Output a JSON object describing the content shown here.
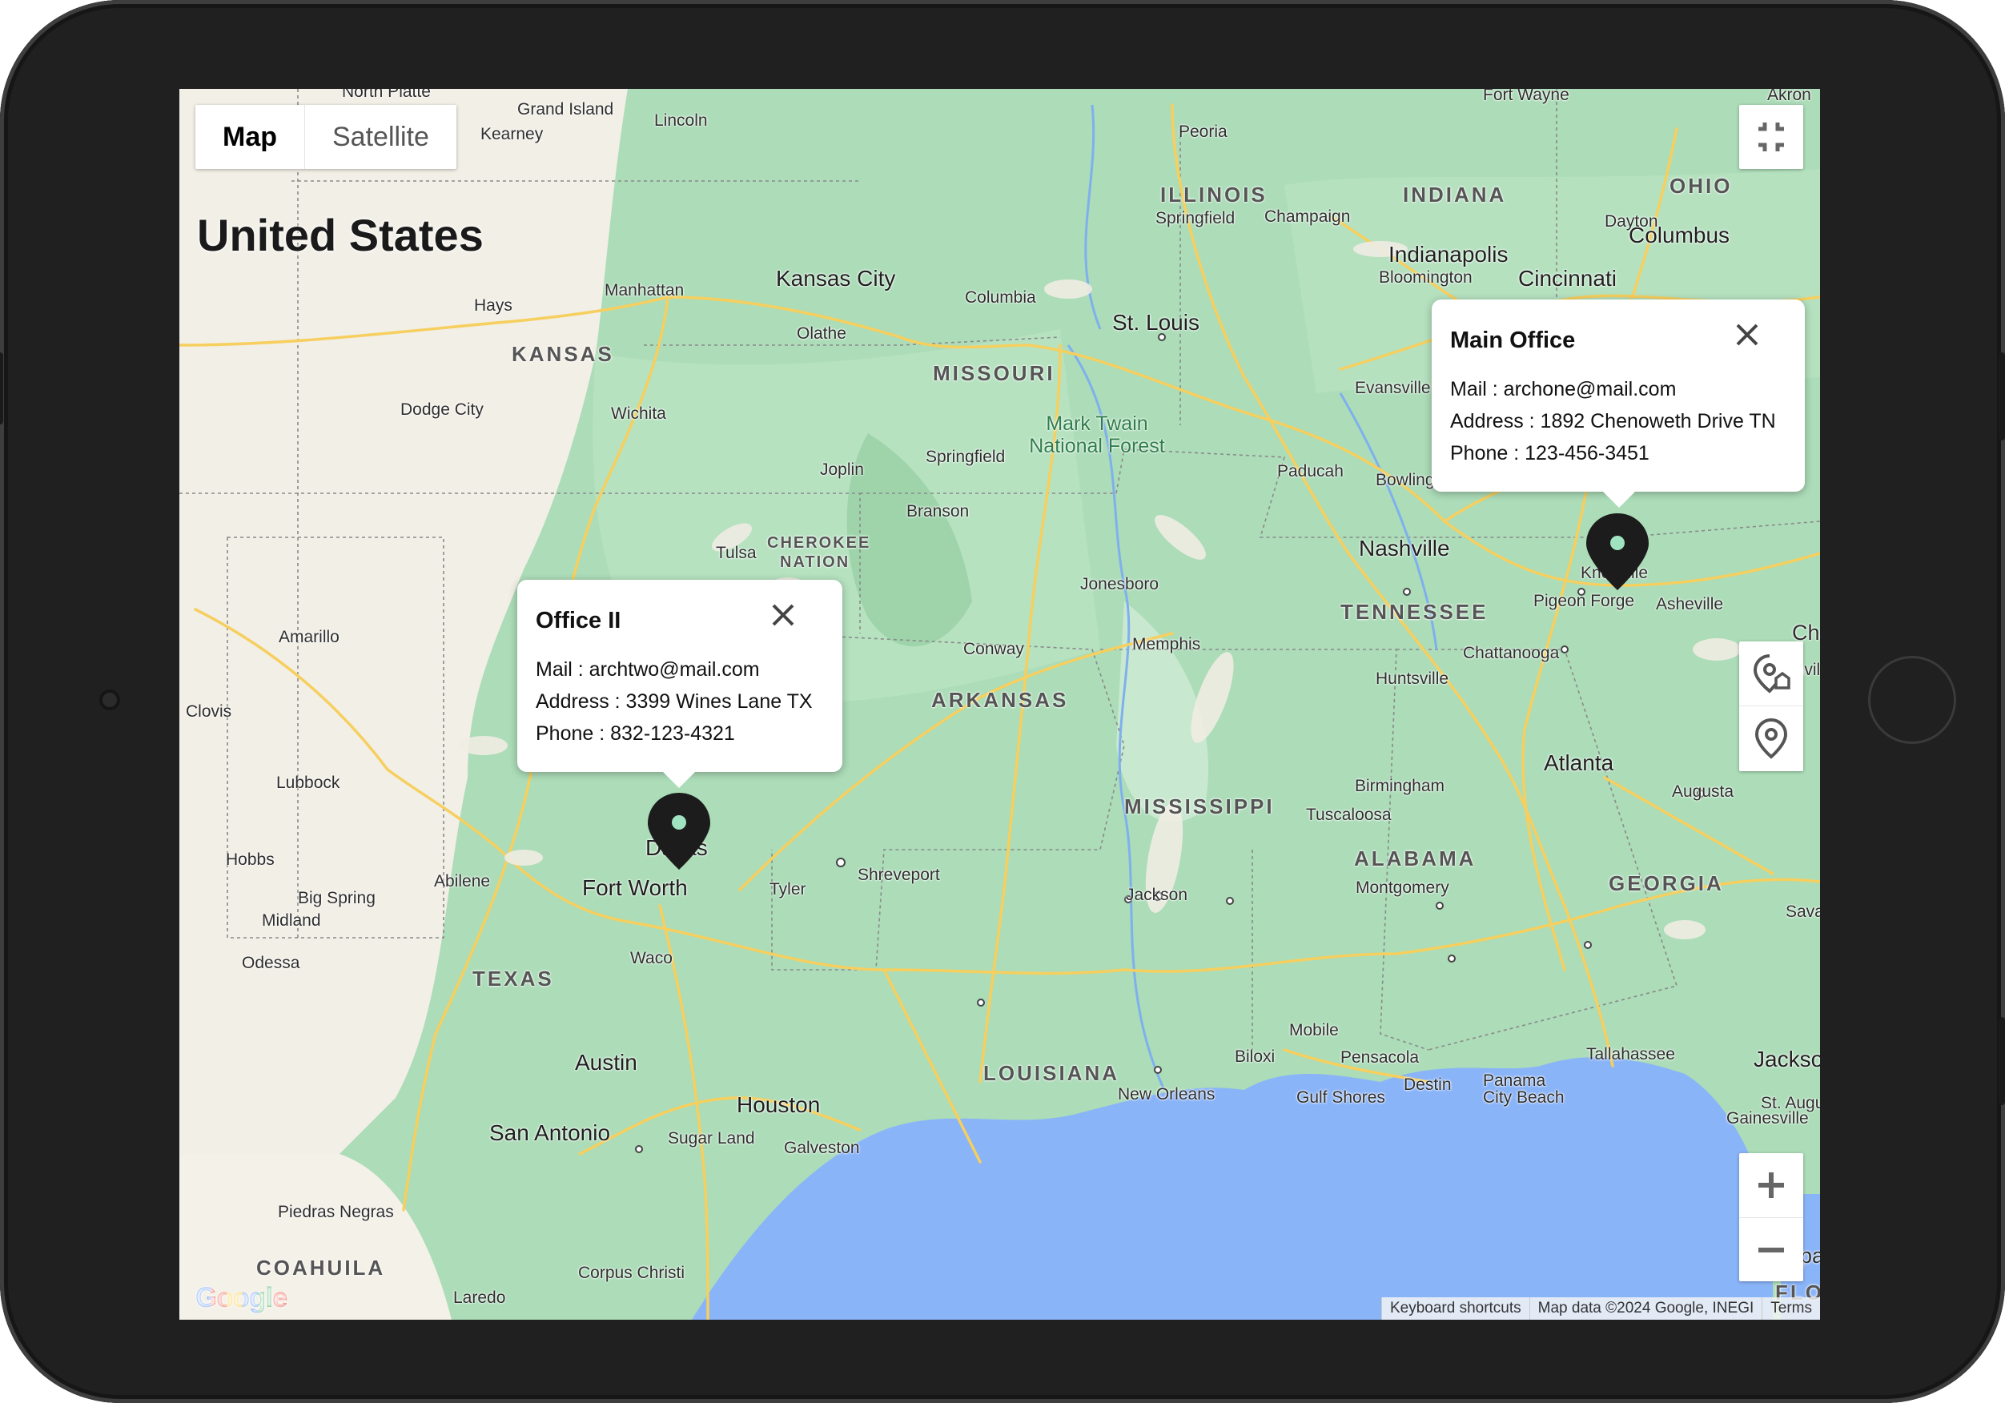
{
  "map": {
    "type_control": {
      "map_label": "Map",
      "satellite_label": "Satellite"
    },
    "country_label": "United States",
    "states": [
      "KANSAS",
      "MISSOURI",
      "ILLINOIS",
      "INDIANA",
      "OHIO",
      "TENNESSEE",
      "ARKANSAS",
      "MISSISSIPPI",
      "ALABAMA",
      "GEORGIA",
      "TEXAS",
      "LOUISIANA",
      "CHEROKEE",
      "NATION",
      "COAHUILA",
      "FLORIDA"
    ],
    "big_cities": [
      "Kansas City",
      "St. Louis",
      "Indianapolis",
      "Columbus",
      "Cincinnati",
      "Nashville",
      "Atlanta",
      "Fort Worth",
      "Dallas",
      "Austin",
      "Houston",
      "San Antonio",
      "Jacksonville"
    ],
    "cities": [
      "North Platte",
      "Grand Island",
      "Lincoln",
      "Kearney",
      "Peoria",
      "Fort Wayne",
      "Akron",
      "Springfield",
      "Champaign",
      "Dayton",
      "Manhattan",
      "Olathe",
      "Columbia",
      "Bloomington",
      "Hays",
      "Evansville",
      "Dodge City",
      "Wichita",
      "Springfield",
      "Joplin",
      "Paducah",
      "Bowling Green",
      "Branson",
      "Tulsa",
      "Jonesboro",
      "Amarillo",
      "Memphis",
      "Conway",
      "Knoxville",
      "Pigeon Forge",
      "Asheville",
      "Chattanooga",
      "Clovis",
      "Huntsville",
      "Greenville",
      "Lubbock",
      "Birmingham",
      "Tuscaloosa",
      "Augusta",
      "Hobbs",
      "Abilene",
      "Big Spring",
      "Midland",
      "Odessa",
      "Tyler",
      "Shreveport",
      "Jackson",
      "Montgomery",
      "Waco",
      "Mobile",
      "Biloxi",
      "Pensacola",
      "Destin",
      "Panama City Beach",
      "Gulf Shores",
      "Tallahassee",
      "New Orleans",
      "Gainesville",
      "Sugar Land",
      "Galveston",
      "Piedras Negras",
      "Corpus Christi",
      "Laredo",
      "St. Augustine",
      "Tampa",
      "Savannah",
      "Charlotte"
    ],
    "forest_label": "Mark Twain National Forest",
    "google_logo": "Google",
    "footer": {
      "shortcuts": "Keyboard shortcuts",
      "data": "Map data ©2024 Google, INEGI",
      "terms": "Terms"
    }
  },
  "popups": {
    "main_office": {
      "title": "Main Office",
      "mail": "Mail : archone@mail.com",
      "address": "Address : 1892 Chenoweth Drive TN",
      "phone": "Phone : 123-456-3451"
    },
    "office_two": {
      "title": "Office II",
      "mail": "Mail : archtwo@mail.com",
      "address": "Address : 3399 Wines Lane TX",
      "phone": "Phone : 832-123-4321"
    }
  },
  "colors": {
    "land": "#acdcb8",
    "dry_land": "#f2efe6",
    "water": "#8ab4f8",
    "highway": "#f9d46b",
    "marker": "#1c1c1c",
    "marker_dot": "#9fe3c0",
    "tablet_frame": "#202020"
  },
  "icons": [
    "fullscreen-exit-icon",
    "location-home-icon",
    "location-pin-icon",
    "zoom-in-icon",
    "zoom-out-icon",
    "close-icon",
    "map-marker-icon"
  ]
}
